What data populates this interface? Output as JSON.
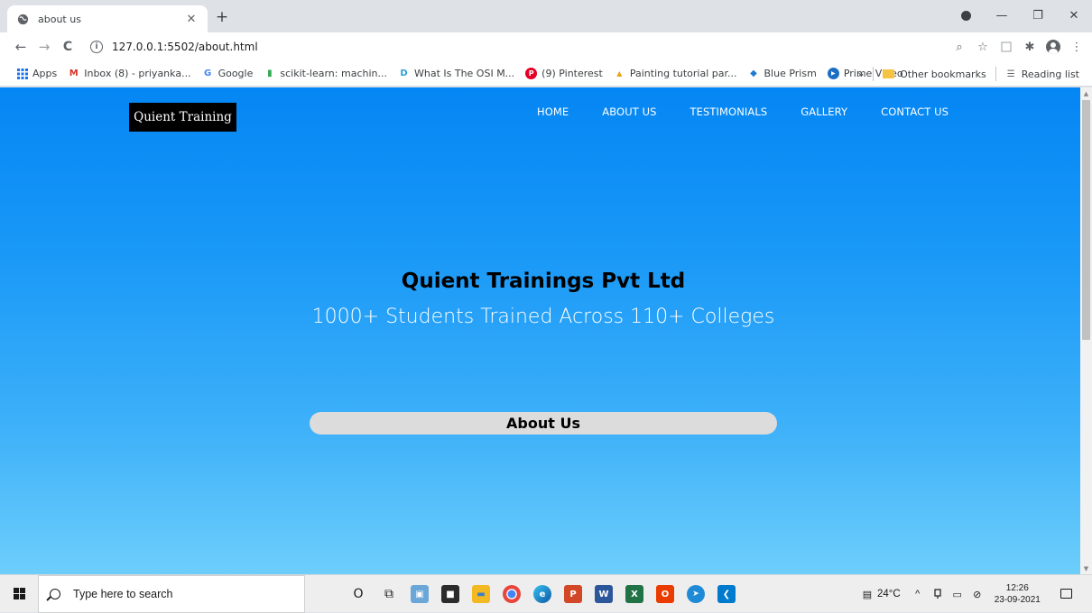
{
  "browser": {
    "tab": {
      "title": "about us",
      "close_glyph": "✕",
      "favicon": "globe-icon"
    },
    "new_tab_glyph": "+",
    "window": {
      "minimize_glyph": "—",
      "restore_glyph": "❐",
      "close_glyph": "✕"
    },
    "nav": {
      "back_glyph": "←",
      "forward_glyph": "→",
      "reload_glyph": "C"
    },
    "address": {
      "info_glyph": "i",
      "url": "127.0.0.1:5502/about.html"
    },
    "toolbar_icons": {
      "zoom_glyph": "⌕",
      "star_glyph": "☆",
      "extensions_glyph": "✱",
      "menu_glyph": "⋮"
    },
    "bookmarks": [
      {
        "label": "Apps",
        "icon": "apps-grid-icon",
        "color": "#1a73e8"
      },
      {
        "label": "Inbox (8) - priyanka...",
        "icon": "gmail-icon",
        "glyph": "M",
        "color": "#d93025"
      },
      {
        "label": "Google",
        "icon": "google-icon",
        "glyph": "G",
        "color": "#4285f4"
      },
      {
        "label": "scikit-learn: machin...",
        "icon": "scikit-icon",
        "glyph": "▮",
        "color": "#34a853"
      },
      {
        "label": "What Is The OSI M...",
        "icon": "osi-icon",
        "glyph": "D",
        "color": "#2b9fd6"
      },
      {
        "label": "(9) Pinterest",
        "icon": "pinterest-icon",
        "glyph": "P",
        "color": "#e60023"
      },
      {
        "label": "Painting tutorial par...",
        "icon": "painting-icon",
        "glyph": "▲",
        "color": "#e8a317"
      },
      {
        "label": "Blue Prism",
        "icon": "blue-prism-icon",
        "glyph": "◆",
        "color": "#1f7ad6"
      },
      {
        "label": "Prime Video",
        "icon": "prime-video-icon",
        "glyph": "▶",
        "color": "#1c6ec4"
      }
    ],
    "bookmarks_overflow": "»",
    "other_bookmarks": "Other bookmarks",
    "reading_list": "Reading list",
    "reading_list_glyph": "☰"
  },
  "site": {
    "brand": "Quient Training",
    "nav": [
      "HOME",
      "ABOUT US",
      "TESTIMONIALS",
      "GALLERY",
      "CONTACT US"
    ],
    "hero_title": "Quient Trainings Pvt Ltd",
    "hero_subtitle": "1000+ Students Trained Across 110+ Colleges",
    "section_heading": "About Us",
    "colors": {
      "gradient_top": "#0486f4",
      "gradient_bottom": "#6dcefb",
      "brand_bg": "#000000",
      "about_bar_bg": "#dcdcdc"
    }
  },
  "scrollbar": {
    "up_glyph": "▲",
    "down_glyph": "▼"
  },
  "taskbar": {
    "search_placeholder": "Type here to search",
    "apps": [
      {
        "name": "cortana",
        "glyph": "O",
        "color": "#eeeeee",
        "text": "#1a1a1a"
      },
      {
        "name": "task-view",
        "glyph": "⧉",
        "color": "#eeeeee",
        "text": "#1a1a1a"
      },
      {
        "name": "photos",
        "glyph": "▣",
        "color": "#6aa7d8",
        "text": "#ffffff"
      },
      {
        "name": "store",
        "glyph": "■",
        "color": "#2b2b2b",
        "text": "#ffffff"
      },
      {
        "name": "file-explorer",
        "glyph": "▬",
        "color": "#f2b922",
        "text": "#ffffff"
      },
      {
        "name": "chrome",
        "glyph": "●",
        "color": "#e8453c",
        "text": "#fbbc05"
      },
      {
        "name": "edge",
        "glyph": "e",
        "color": "#1f8ad6",
        "text": "#ffffff"
      },
      {
        "name": "powerpoint",
        "glyph": "P",
        "color": "#d24726",
        "text": "#ffffff"
      },
      {
        "name": "word",
        "glyph": "W",
        "color": "#2b579a",
        "text": "#ffffff"
      },
      {
        "name": "excel",
        "glyph": "X",
        "color": "#217346",
        "text": "#ffffff"
      },
      {
        "name": "office",
        "glyph": "O",
        "color": "#eb3c00",
        "text": "#ffffff"
      },
      {
        "name": "safari-like",
        "glyph": "➤",
        "color": "#1f8ad6",
        "text": "#ffffff"
      },
      {
        "name": "vscode",
        "glyph": "❮",
        "color": "#007acc",
        "text": "#ffffff"
      }
    ],
    "tray": {
      "news_glyph": "▤",
      "weather": "24°C",
      "chevron_glyph": "^",
      "battery_glyph": "▭",
      "network_glyph": "⊘",
      "time": "12:26",
      "date": "23-09-2021"
    }
  }
}
